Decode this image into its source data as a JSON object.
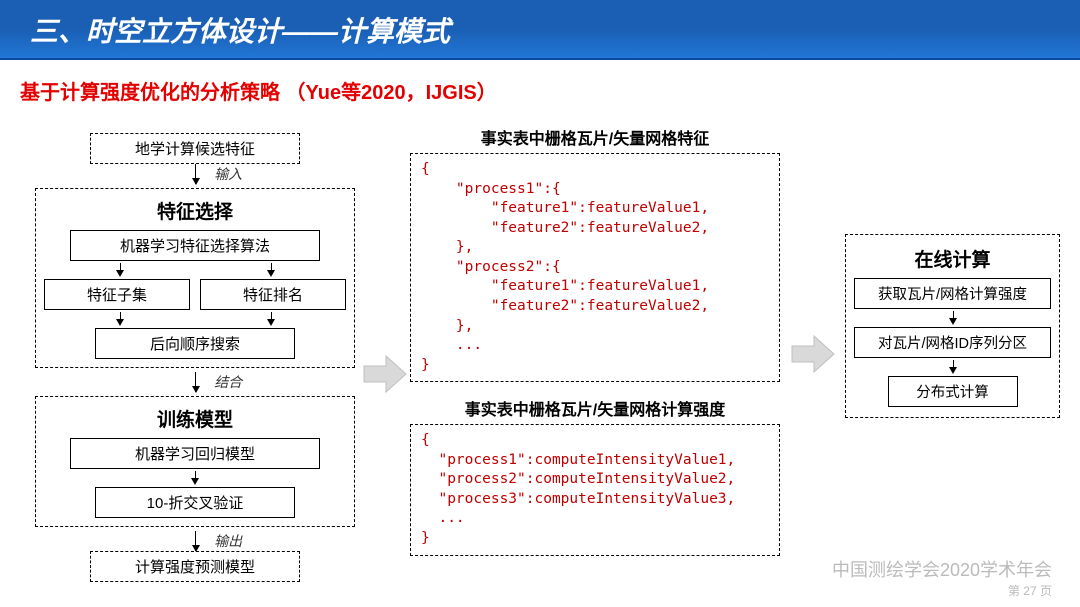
{
  "header": {
    "title": "三、时空立方体设计——计算模式"
  },
  "subtitle": "基于计算强度优化的分析策略 （Yue等2020，IJGIS）",
  "left": {
    "candidate": "地学计算候选特征",
    "input_label": "输入",
    "feature_selection": {
      "title": "特征选择",
      "algo": "机器学习特征选择算法",
      "subset": "特征子集",
      "ranking": "特征排名",
      "backward": "后向顺序搜索"
    },
    "combine_label": "结合",
    "train_model": {
      "title": "训练模型",
      "regression": "机器学习回归模型",
      "crossval": "10-折交叉验证"
    },
    "output_label": "输出",
    "predict": "计算强度预测模型"
  },
  "mid": {
    "t1": "事实表中栅格瓦片/矢量网格特征",
    "code1": "{\n    \"process1\":{\n        \"feature1\":featureValue1,\n        \"feature2\":featureValue2,\n    },\n    \"process2\":{\n        \"feature1\":featureValue1,\n        \"feature2\":featureValue2,\n    },\n    ...\n}",
    "t2": "事实表中栅格瓦片/矢量网格计算强度",
    "code2": "{\n  \"process1\":computeIntensityValue1,\n  \"process2\":computeIntensityValue2,\n  \"process3\":computeIntensityValue3,\n  ...\n}"
  },
  "right": {
    "title": "在线计算",
    "s1": "获取瓦片/网格计算强度",
    "s2": "对瓦片/网格ID序列分区",
    "s3": "分布式计算"
  },
  "footer": {
    "org": "中国测绘学会2020学术年会",
    "page": "第 27 页"
  }
}
